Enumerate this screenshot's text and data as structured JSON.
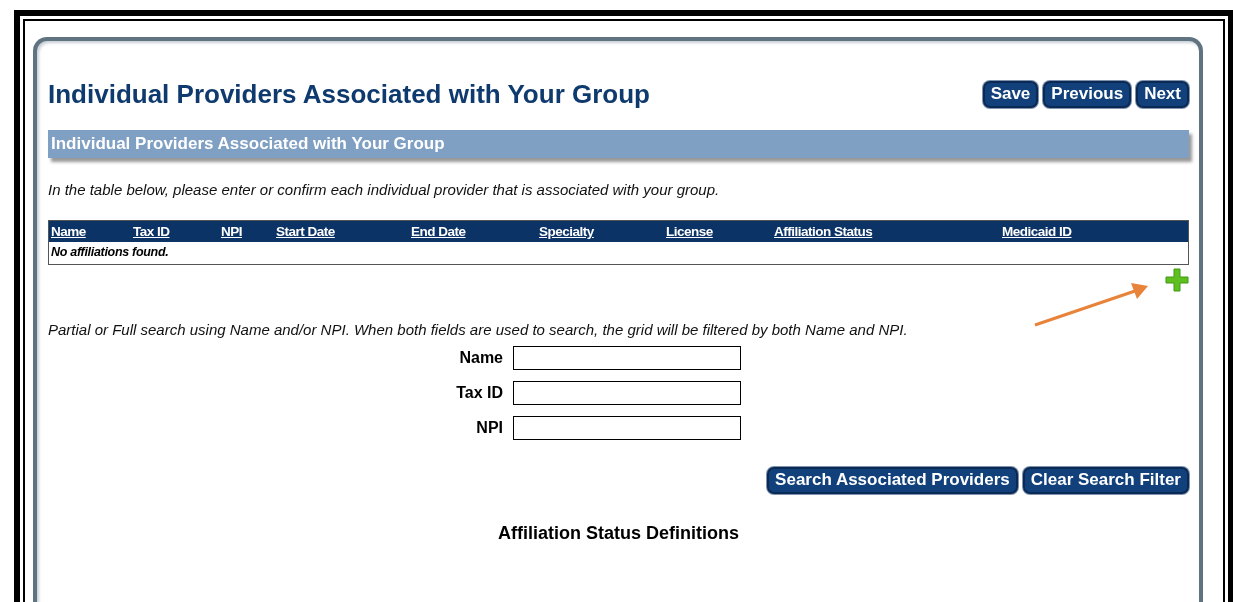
{
  "page": {
    "title": "Individual Providers Associated with Your Group",
    "buttons": [
      "Save",
      "Previous",
      "Next"
    ]
  },
  "section": {
    "title": "Individual Providers Associated with Your Group",
    "instruction": "In the table below, please enter or confirm each individual provider that is associated with your group."
  },
  "table": {
    "columns": [
      "Name",
      "Tax ID",
      "NPI",
      "Start Date",
      "End Date",
      "Specialty",
      "License",
      "Affiliation Status",
      "Medicaid ID"
    ],
    "empty_message": "No affiliations found."
  },
  "search": {
    "hint": "Partial or Full search using Name and/or NPI. When both fields are used to search, the grid will be filtered by both Name and NPI.",
    "fields": [
      {
        "label": "Name"
      },
      {
        "label": "Tax ID"
      },
      {
        "label": "NPI"
      }
    ],
    "buttons": [
      "Search Associated Providers",
      "Clear Search Filter"
    ]
  },
  "definitions": {
    "title": "Affiliation Status Definitions"
  }
}
